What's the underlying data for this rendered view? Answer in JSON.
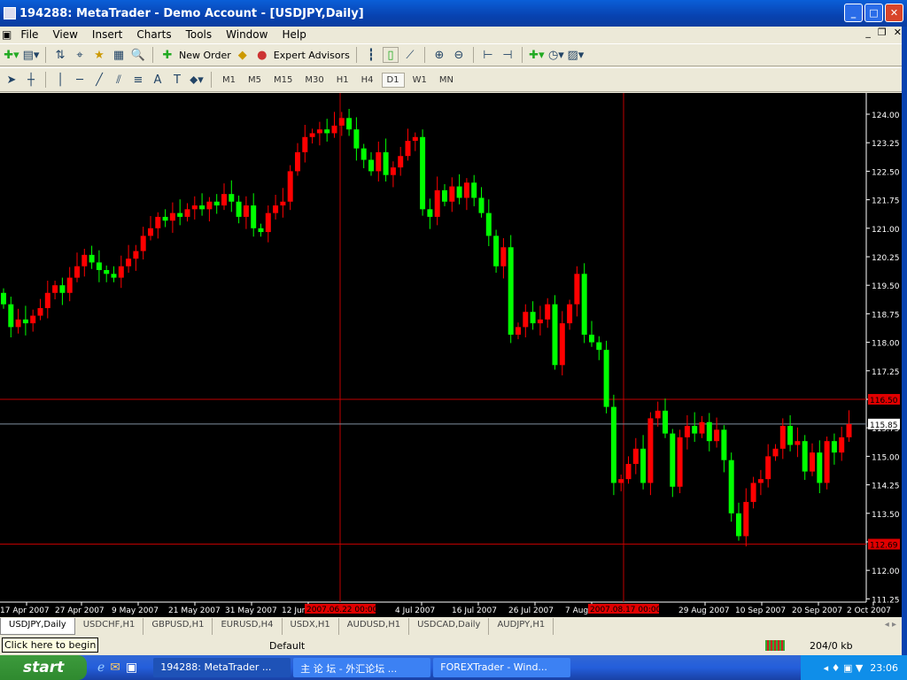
{
  "window": {
    "title": "194288: MetaTrader - Demo Account - [USDJPY,Daily]"
  },
  "menu": [
    "File",
    "View",
    "Insert",
    "Charts",
    "Tools",
    "Window",
    "Help"
  ],
  "toolbar": {
    "new_order": "New Order",
    "expert_advisors": "Expert Advisors"
  },
  "timeframes": [
    "M1",
    "M5",
    "M15",
    "M30",
    "H1",
    "H4",
    "D1",
    "W1",
    "MN"
  ],
  "active_timeframe": "D1",
  "chart": {
    "symbol": "USDJPY",
    "period": "Daily",
    "price_ticks": [
      "124.00",
      "123.25",
      "122.50",
      "121.75",
      "121.00",
      "120.25",
      "119.50",
      "118.75",
      "118.00",
      "117.25",
      "116.50",
      "115.75",
      "115.00",
      "114.25",
      "113.50",
      "112.75",
      "112.00",
      "111.25"
    ],
    "date_labels": [
      "17 Apr 2007",
      "27 Apr 2007",
      "9 May 2007",
      "21 May 2007",
      "31 May 2007",
      "12 Jun 2007",
      "4 Jul 2007",
      "16 Jul 2007",
      "26 Jul 2007",
      "7 Aug 2007",
      "29 Aug 2007",
      "10 Sep 2007",
      "20 Sep 2007",
      "2 Oct 2007"
    ],
    "crosshair_dates": [
      "2007.06.22 00:00",
      "2007.08.17 00:00"
    ],
    "crosshair_prices": [
      "116.50",
      "112.69"
    ],
    "current_price": "115.85",
    "colors": {
      "bull": "#ff0000",
      "bear": "#00ff00",
      "background": "#000000",
      "crosshair": "#c00000",
      "bid_line": "#8090a0"
    },
    "closes": [
      119.0,
      118.4,
      118.6,
      118.5,
      118.7,
      118.9,
      119.3,
      119.5,
      119.3,
      119.7,
      120.0,
      120.3,
      120.1,
      119.9,
      119.8,
      119.7,
      120.0,
      120.2,
      120.4,
      120.8,
      121.0,
      121.3,
      121.2,
      121.4,
      121.3,
      121.5,
      121.6,
      121.5,
      121.7,
      121.6,
      121.9,
      121.7,
      121.3,
      121.6,
      121.0,
      120.9,
      121.4,
      121.6,
      121.7,
      122.5,
      123.0,
      123.4,
      123.5,
      123.6,
      123.5,
      123.7,
      123.9,
      123.6,
      123.1,
      122.8,
      122.5,
      123.0,
      122.4,
      122.6,
      122.9,
      123.3,
      123.4,
      121.5,
      121.3,
      122.0,
      121.7,
      122.1,
      121.8,
      122.2,
      121.8,
      121.4,
      120.8,
      120.0,
      120.5,
      118.2,
      118.4,
      118.8,
      118.5,
      118.6,
      119.0,
      117.4,
      118.5,
      119.0,
      119.8,
      118.2,
      118.0,
      117.8,
      116.3,
      114.3,
      114.4,
      114.8,
      115.2,
      114.3,
      116.0,
      116.2,
      115.6,
      114.2,
      115.5,
      115.8,
      115.6,
      115.9,
      115.4,
      115.7,
      114.9,
      113.5,
      112.9,
      113.8,
      114.3,
      114.4,
      115.0,
      115.2,
      115.8,
      115.3,
      115.4,
      114.6,
      115.1,
      114.3,
      115.4,
      115.1,
      115.5,
      115.85
    ]
  },
  "tabs": [
    "USDJPY,Daily",
    "USDCHF,H1",
    "GBPUSD,H1",
    "EURUSD,H4",
    "USDX,H1",
    "AUDUSD,H1",
    "USDCAD,Daily",
    "AUDJPY,H1"
  ],
  "status": {
    "tooltip": "Click here to begin",
    "profile": "Default",
    "traffic": "204/0 kb"
  },
  "taskbar": {
    "start": "start",
    "tasks": [
      "194288: MetaTrader ...",
      "主 论 坛 - 外汇论坛 ...",
      "FOREXTrader - Wind..."
    ],
    "clock": "23:06"
  }
}
